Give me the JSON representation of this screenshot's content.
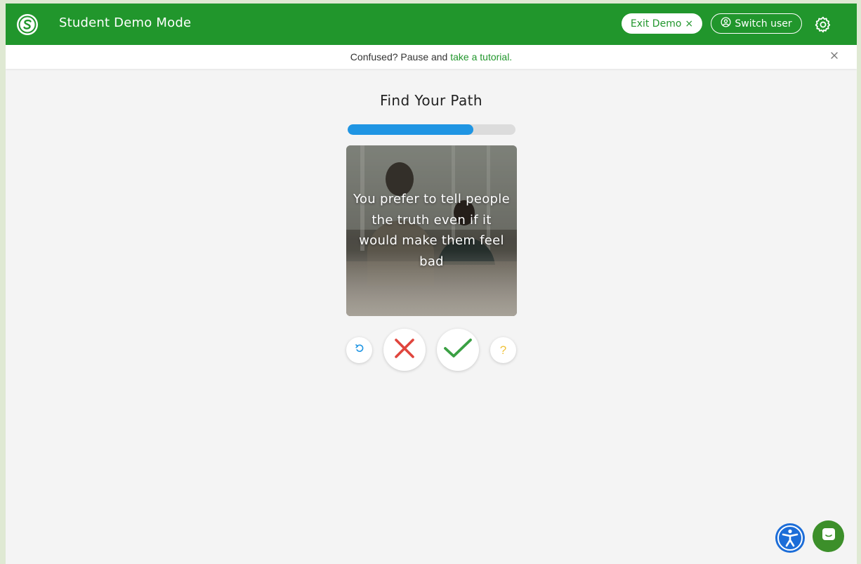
{
  "header": {
    "title": "Student Demo Mode",
    "exit_label": "Exit Demo",
    "exit_icon": "×",
    "switch_label": "Switch user",
    "brand_color": "#21962c"
  },
  "banner": {
    "text": "Confused? Pause and",
    "link_text": "take a tutorial.",
    "close_icon": "close-icon"
  },
  "main": {
    "title": "Find Your Path",
    "progress": 0.75,
    "progress_color": "#1f95e3",
    "card_text": "You prefer to tell people the truth even if it would make them feel bad",
    "help_label": "?"
  },
  "icons": {
    "undo": "undo-icon",
    "reject": "x-icon",
    "accept": "check-icon",
    "help": "question-icon",
    "settings": "gear-icon",
    "accessibility": "accessibility-icon",
    "chat": "chat-icon"
  }
}
